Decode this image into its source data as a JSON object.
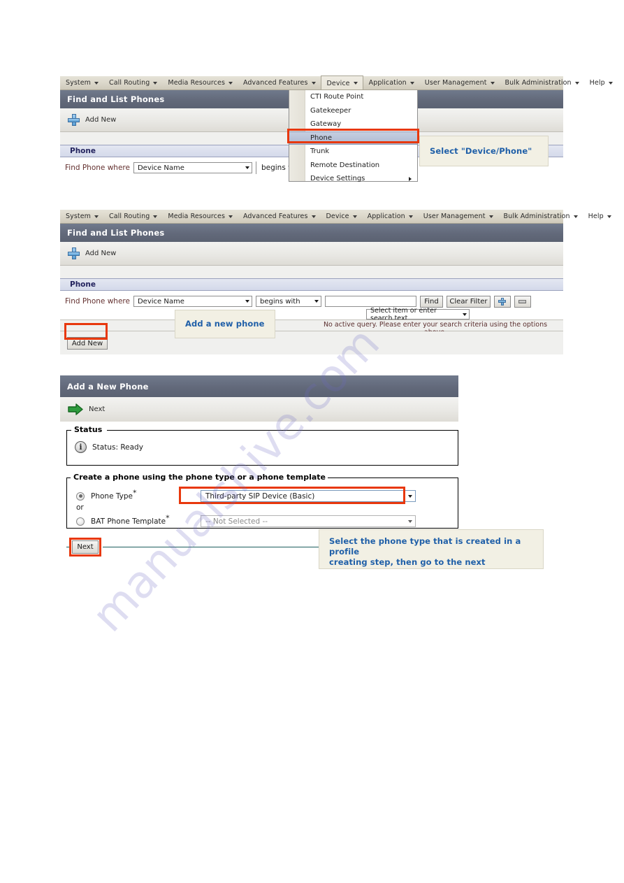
{
  "watermark": {
    "text": "manualshive.com"
  },
  "menu": {
    "items": [
      {
        "label": "System"
      },
      {
        "label": "Call Routing"
      },
      {
        "label": "Media Resources"
      },
      {
        "label": "Advanced Features"
      },
      {
        "label": "Device"
      },
      {
        "label": "Application"
      },
      {
        "label": "User Management"
      },
      {
        "label": "Bulk Administration"
      },
      {
        "label": "Help"
      }
    ]
  },
  "panel1": {
    "title": "Find and List Phones",
    "toolbar": {
      "add_new_label": "Add New"
    },
    "section_header": "Phone",
    "search": {
      "find_label": "Find Phone where",
      "field_value": "Device Name",
      "operator_value": "begins with"
    },
    "device_menu": {
      "items": [
        {
          "label": "CTI Route Point",
          "highlighted": false,
          "submenu": false
        },
        {
          "label": "Gatekeeper",
          "highlighted": false,
          "submenu": false
        },
        {
          "label": "Gateway",
          "highlighted": false,
          "submenu": false
        },
        {
          "label": "Phone",
          "highlighted": true,
          "submenu": false
        },
        {
          "label": "Trunk",
          "highlighted": false,
          "submenu": false
        },
        {
          "label": "Remote Destination",
          "highlighted": false,
          "submenu": false
        },
        {
          "label": "Device Settings",
          "highlighted": false,
          "submenu": true
        }
      ]
    },
    "callout": {
      "text": "Select  \"Device/Phone\""
    }
  },
  "panel2": {
    "title": "Find and List Phones",
    "toolbar": {
      "add_new_label": "Add New"
    },
    "section_header": "Phone",
    "search": {
      "find_label": "Find Phone where",
      "field_value": "Device Name",
      "operator_value": "begins with",
      "text_value": "",
      "text_placeholder": "",
      "item_select_value": "Select item or enter search text",
      "find_button": "Find",
      "clear_filter_button": "Clear Filter",
      "add_criteria_icon": "plus-icon",
      "remove_criteria_icon": "minus-icon"
    },
    "no_query_message": "No active query. Please enter your search criteria using the options above.",
    "add_new_button": "Add New",
    "callout": {
      "text": "Add a new phone"
    }
  },
  "panel3": {
    "title": "Add a New Phone",
    "toolbar": {
      "next_label": "Next"
    },
    "status_fieldset": {
      "legend": "Status",
      "status_text": "Status: Ready",
      "icon": "info-icon"
    },
    "create_fieldset": {
      "legend": "Create a phone using the phone type or a phone template",
      "phone_type": {
        "label": "Phone Type",
        "required_marker": "*",
        "selected": true,
        "value": "Third-party SIP Device (Basic)"
      },
      "or_label": "or",
      "bat_template": {
        "label": "BAT Phone Template",
        "required_marker": "*",
        "selected": false,
        "value": "-- Not Selected --"
      }
    },
    "next_button": "Next",
    "callout": {
      "line1": "Select the phone type that is created in a profile",
      "line2": "creating step, then go to the next"
    }
  },
  "colors": {
    "highlight_red": "#e8380d",
    "title_bar": "#62697a",
    "menu_bar": "#dcd8cb",
    "callout_bg": "#f2f0e4",
    "callout_text": "#1f5fa8",
    "section_header_bg": "#d8dceb"
  }
}
